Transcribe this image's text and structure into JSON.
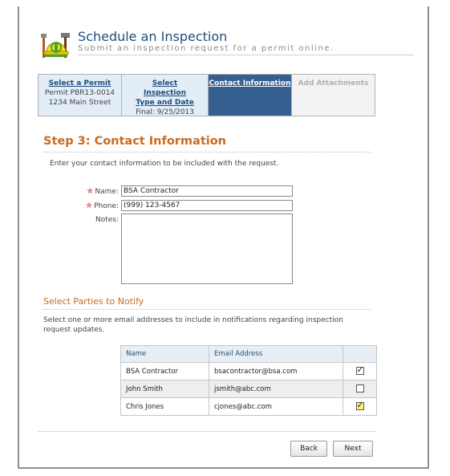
{
  "header": {
    "title": "Schedule an Inspection",
    "subtitle": "Submit an inspection request for a permit online."
  },
  "steps": [
    {
      "label": "Select a Permit",
      "lines": [
        "Permit PBR13-0014",
        "1234 Main Street"
      ],
      "state": "completed"
    },
    {
      "label": "Select Inspection Type and Date",
      "lines": [
        "Final: 9/25/2013"
      ],
      "state": "completed"
    },
    {
      "label": "Contact Information",
      "lines": [],
      "state": "active"
    },
    {
      "label": "Add Attachments",
      "lines": [],
      "state": "disabled"
    }
  ],
  "step_heading": "Step 3: Contact Information",
  "intro": "Enter your contact information to be included with the request.",
  "form": {
    "name_label": "Name:",
    "name_value": "BSA Contractor",
    "phone_label": "Phone:",
    "phone_value": "(999) 123-4567",
    "notes_label": "Notes:"
  },
  "parties": {
    "heading": "Select Parties to Notify",
    "description": "Select one or more email addresses to include in notifications regarding inspection request updates.",
    "columns": [
      "Name",
      "Email Address"
    ],
    "rows": [
      {
        "name": "BSA Contractor",
        "email": "bsacontractor@bsa.com",
        "checked": true
      },
      {
        "name": "John Smith",
        "email": "jsmith@abc.com",
        "checked": false
      },
      {
        "name": "Chris Jones",
        "email": "cjones@abc.com",
        "checked": true
      }
    ]
  },
  "buttons": {
    "back": "Back",
    "next": "Next"
  },
  "colors": {
    "accent_orange": "#cc6a1c",
    "active_step": "#365f91",
    "title_blue": "#1f4e79"
  }
}
